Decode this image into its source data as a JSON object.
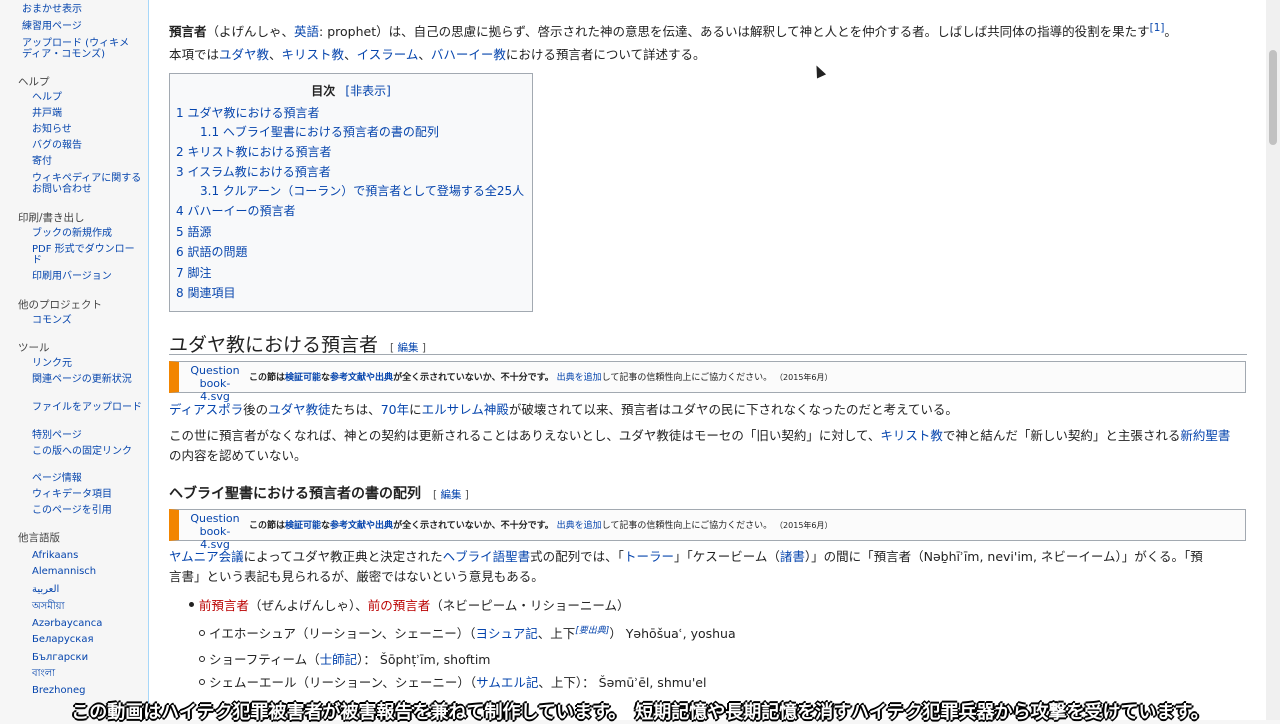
{
  "sidebar": {
    "top_items": [
      "おまかせ表示",
      "練習用ページ",
      "アップロード (ウィキメディア・コモンズ)"
    ],
    "help_head": "ヘルプ",
    "help_items": [
      "ヘルプ",
      "井戸端",
      "お知らせ",
      "バグの報告",
      "寄付",
      "ウィキペディアに関するお問い合わせ"
    ],
    "print_head": "印刷/書き出し",
    "print_items": [
      "ブックの新規作成",
      "PDF 形式でダウンロード",
      "印刷用バージョン"
    ],
    "projects_head": "他のプロジェクト",
    "projects_items": [
      "コモンズ"
    ],
    "tools_head": "ツール",
    "tools_items": [
      "リンク元",
      "関連ページの更新状況",
      "ファイルをアップロード",
      "特別ページ",
      "この版への固定リンク",
      "ページ情報",
      "ウィキデータ項目",
      "このページを引用"
    ],
    "lang_head": "他言語版",
    "lang_items": [
      "Afrikaans",
      "Alemannisch",
      "العربية",
      "অসমীয়া",
      "Azərbaycanca",
      "Беларуская",
      "Български",
      "বাংলা",
      "Brezhoneg"
    ]
  },
  "article": {
    "intro_term": "預言者",
    "intro_1": "（よげんしゃ、",
    "intro_link_en": "英語",
    "intro_2": ": prophet）は、自己の思慮に拠らず、啓示された神の意思を伝達、あるいは解釈して神と人とを仲介する者。しばしば共同体の指導的役割を果たす",
    "intro_ref": "[1]",
    "intro_end": "。",
    "scope_1": "本項では",
    "scope_judaism": "ユダヤ教",
    "scope_christ": "キリスト教",
    "scope_islam": "イスラーム",
    "scope_bahai": "バハーイー教",
    "scope_2": "における預言者について詳述する。",
    "sep": "、"
  },
  "toc": {
    "title": "目次",
    "toggle": "[非表示]",
    "items": [
      "1 ユダヤ教における預言者",
      "1.1 ヘブライ聖書における預言者の書の配列",
      "2 キリスト教における預言者",
      "3 イスラム教における預言者",
      "3.1 クルアーン（コーラン）で預言者として登場する全25人",
      "4 バハーイーの預言者",
      "5 語源",
      "6 訳語の問題",
      "7 脚注",
      "8 関連項目"
    ]
  },
  "section1": {
    "heading": "ユダヤ教における預言者",
    "edit_open": "[",
    "edit": "編集",
    "edit_close": "]",
    "ambox_img": "Question book-4.svg",
    "ambox_a": "この節は",
    "ambox_link1": "検証可能",
    "ambox_b": "な",
    "ambox_link2": "参考文献や出典",
    "ambox_c": "が全く示されていないか、不十分です。",
    "ambox_link3": "出典を追加",
    "ambox_d": "して記事の信頼性向上にご協力ください。",
    "ambox_date": "（2015年6月）",
    "p1_link1": "ディアスポラ",
    "p1_a": "後の",
    "p1_link2": "ユダヤ教徒",
    "p1_b": "たちは、",
    "p1_link3": "70年",
    "p1_c": "に",
    "p1_link4": "エルサレム神殿",
    "p1_d": "が破壊されて以来、預言者はユダヤの民に下されなくなったのだと考えている。",
    "p2_a": "この世に預言者がなくなれば、神との契約は更新されることはありえないとし、ユダヤ教徒はモーセの「旧い契約」に対して、",
    "p2_link1": "キリスト教",
    "p2_b": "で神と結んだ「新しい契約」と主張される",
    "p2_link2": "新約聖書",
    "p2_c": "の内容を認めていない。"
  },
  "section2": {
    "heading": "ヘブライ聖書における預言者の書の配列",
    "p1_link1": "ヤムニア会議",
    "p1_a": "によってユダヤ教正典と決定された",
    "p1_link2": "ヘブライ語聖書",
    "p1_b": "式の配列では、「",
    "p1_link3": "トーラー",
    "p1_c": "」「ケスービーム（",
    "p1_link4": "諸書",
    "p1_d": "）」の間に「預言者（Nəḇhīʾīm, nevi'im, ネビーイーム）」がくる。「預",
    "p1_line2": "言書」という表記も見られるが、厳密ではないという意見もある。",
    "li1_link1": "前預言者",
    "li1_a": "（ぜんよげんしゃ）、",
    "li1_link2": "前の預言者",
    "li1_b": "（ネビーピーム・リショーニーム）",
    "li2_a": "イエホーシュア（リーショーン、シェーニー）（",
    "li2_link": "ヨシュア記",
    "li2_b": "、上下",
    "li2_sup": "[要出典]",
    "li2_c": "）  Yəhōšuaʿ, yoshua",
    "li3_a": "ショーフティーム（",
    "li3_link": "士師記",
    "li3_b": "）：  Šōphṭʾīm, shoftim",
    "li4_a": "シェムーエール（リーショーン、シェーニー）（",
    "li4_link": "サムエル記",
    "li4_b": "、上下）：  Šəmūʾēl, shmu'el"
  },
  "subtitle": "この動画はハイテク犯罪被害者が被害報告を兼ねて制作しています。　短期記憶や長期記憶を消すハイテク犯罪兵器から攻撃を受けています。"
}
